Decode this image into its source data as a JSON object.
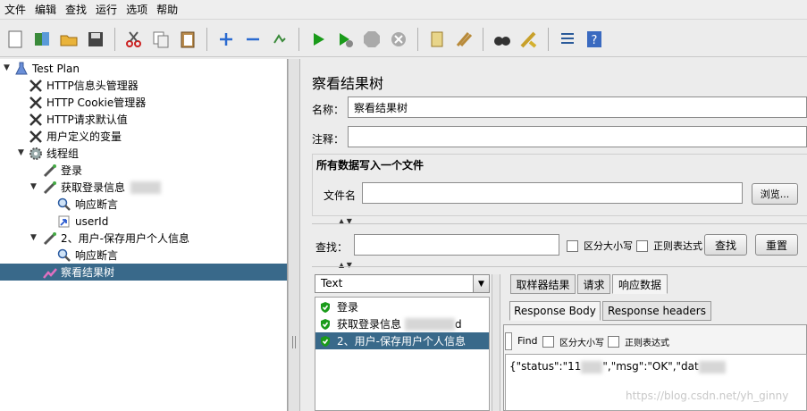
{
  "menu": [
    "文件",
    "编辑",
    "查找",
    "运行",
    "选项",
    "帮助"
  ],
  "toolbar": {
    "icons": [
      "new-icon",
      "templates-icon",
      "open-icon",
      "save-icon",
      "cut-icon",
      "copy-icon",
      "paste-icon",
      "expand-icon",
      "collapse-icon",
      "toggle-icon",
      "start-icon",
      "start-no-pauses-icon",
      "stop-icon",
      "shutdown-icon",
      "clear-icon",
      "clear-all-icon",
      "search-icon",
      "reset-search-icon",
      "function-helper-icon",
      "help-icon"
    ]
  },
  "tree": {
    "items": [
      {
        "label": "Test Plan",
        "icon": "flask-icon"
      },
      {
        "label": "HTTP信息头管理器",
        "icon": "tools-icon"
      },
      {
        "label": "HTTP Cookie管理器",
        "icon": "tools-icon"
      },
      {
        "label": "HTTP请求默认值",
        "icon": "tools-icon"
      },
      {
        "label": "用户定义的变量",
        "icon": "tools-icon"
      },
      {
        "label": "线程组",
        "icon": "gear-icon"
      },
      {
        "label": "登录",
        "icon": "pipette-icon"
      },
      {
        "label": "获取登录信息",
        "icon": "pipette-icon"
      },
      {
        "label": "响应断言",
        "icon": "magnifier-icon"
      },
      {
        "label": "userId",
        "icon": "extractor-icon"
      },
      {
        "label": "2、用户-保存用户个人信息",
        "icon": "pipette-icon"
      },
      {
        "label": "响应断言",
        "icon": "magnifier-icon"
      },
      {
        "label": "察看结果树",
        "icon": "chart-icon"
      }
    ]
  },
  "panel": {
    "title": "察看结果树",
    "name_label": "名称：",
    "name_value": "察看结果树",
    "comment_label": "注释：",
    "comment_value": "",
    "file_group_title": "所有数据写入一个文件",
    "filename_label": "文件名",
    "filename_value": "",
    "browse_label": "浏览...",
    "search_label": "查找：",
    "search_value": "",
    "case_label": "区分大小写",
    "regex_label": "正则表达式",
    "find_button": "查找",
    "reset_button": "重置",
    "renderer": "Text",
    "results": [
      {
        "label": "登录"
      },
      {
        "label": "获取登录信息"
      },
      {
        "label": "2、用户-保存用户个人信息"
      }
    ],
    "result_trailing": "d",
    "tabs": [
      "取样器结果",
      "请求",
      "响应数据"
    ],
    "subtabs": [
      "Response Body",
      "Response headers"
    ],
    "find_label": "Find",
    "case_label_small": "区分大小写",
    "regex_label_small": "正则表达式",
    "response_parts": [
      "{\"status\":\"11",
      "\",\"msg\":\"OK\",\"dat"
    ]
  },
  "watermark": "https://blog.csdn.net/yh_ginny",
  "colors": {
    "selection": "#39698a",
    "accent_green": "#1a9b1a"
  }
}
